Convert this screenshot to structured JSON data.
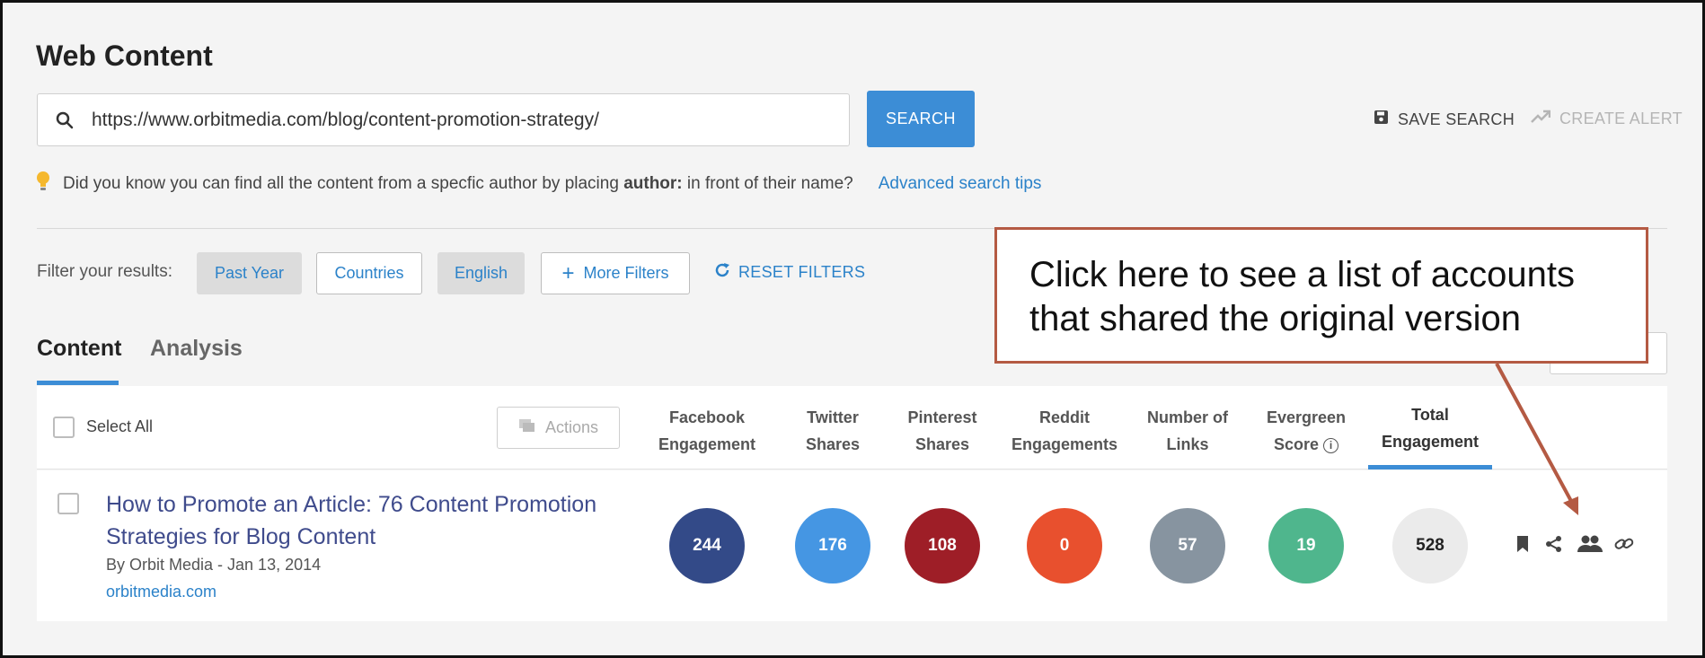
{
  "page": {
    "title": "Web Content"
  },
  "search": {
    "value": "https://www.orbitmedia.com/blog/content-promotion-strategy/",
    "button_label": "SEARCH",
    "save_label": "SAVE SEARCH",
    "alert_label": "CREATE ALERT"
  },
  "tip": {
    "text_before": "Did you know you can find all the content from a specfic author by placing ",
    "keyword": "author:",
    "text_after": " in front of their name?",
    "link": "Advanced search tips"
  },
  "filters": {
    "label": "Filter your results:",
    "chips": [
      "Past Year",
      "Countries",
      "English",
      "More Filters"
    ],
    "reset_label": "RESET FILTERS"
  },
  "tabs": [
    {
      "label": "Content",
      "active": true
    },
    {
      "label": "Analysis",
      "active": false
    }
  ],
  "table": {
    "select_all": "Select All",
    "actions_label": "Actions",
    "columns": [
      {
        "line1": "Facebook",
        "line2": "Engagement"
      },
      {
        "line1": "Twitter",
        "line2": "Shares"
      },
      {
        "line1": "Pinterest",
        "line2": "Shares"
      },
      {
        "line1": "Reddit",
        "line2": "Engagements"
      },
      {
        "line1": "Number of",
        "line2": "Links"
      },
      {
        "line1": "Evergreen",
        "line2": "Score"
      },
      {
        "line1": "Total",
        "line2": "Engagement"
      }
    ],
    "rows": [
      {
        "title": "How to Promote an Article: 76 Content Promotion Strategies for Blog Content",
        "meta": "By Orbit Media - Jan 13, 2014",
        "domain": "orbitmedia.com",
        "values": [
          "244",
          "176",
          "108",
          "0",
          "57",
          "19",
          "528"
        ]
      }
    ]
  },
  "bubble_colors": [
    "#334a88",
    "#4596e3",
    "#9e1e27",
    "#e8502e",
    "#8794a0",
    "#4fb68d",
    "#ebebeb"
  ],
  "icons": {
    "row_actions": [
      "bookmark-icon",
      "share-icon",
      "shared-by-accounts-icon",
      "link-icon"
    ]
  },
  "callout": {
    "line1": "Click here to see a list of accounts",
    "line2": "that shared the original version",
    "border_color": "#b45a43"
  }
}
